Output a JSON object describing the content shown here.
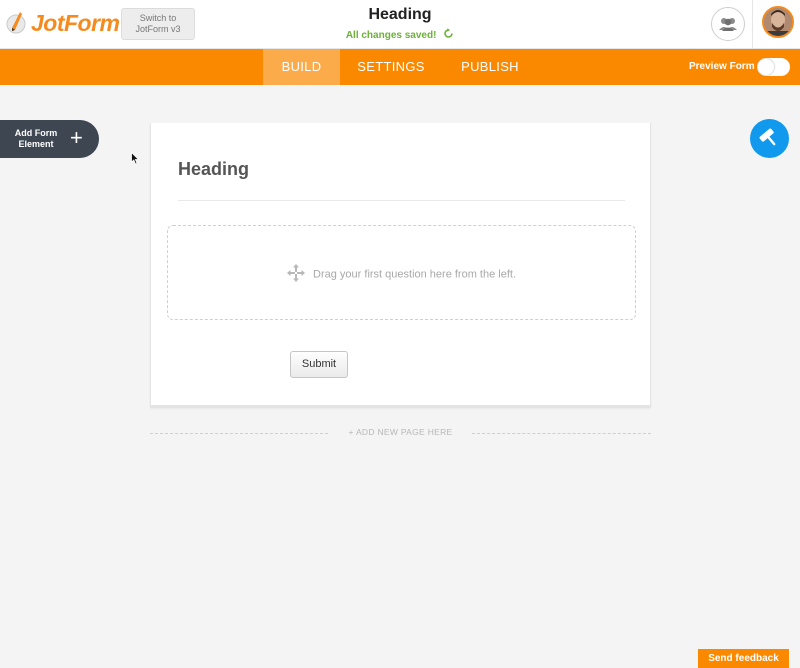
{
  "brand": {
    "name": "JotForm",
    "color": "#f58b1f"
  },
  "header": {
    "switch_line1": "Switch to",
    "switch_line2": "JotForm v3",
    "form_title": "Heading",
    "save_status": "All changes saved!"
  },
  "nav": {
    "tabs": [
      {
        "label": "BUILD",
        "active": true
      },
      {
        "label": "SETTINGS",
        "active": false
      },
      {
        "label": "PUBLISH",
        "active": false
      }
    ],
    "preview_label": "Preview Form",
    "preview_on": false
  },
  "sidebar": {
    "add_element_line1": "Add Form",
    "add_element_line2": "Element",
    "plus_symbol": "+"
  },
  "form": {
    "heading": "Heading",
    "dropzone_text": "Drag your first question here from the left.",
    "submit_label": "Submit",
    "add_page_label": "+ ADD NEW PAGE HERE"
  },
  "footer": {
    "feedback_label": "Send feedback"
  },
  "colors": {
    "orange": "#fa8900",
    "active_tab": "#fbab4a",
    "designer_blue": "#1199ee",
    "dark": "#3d4651",
    "saved_green": "#6bb136"
  },
  "icons": [
    "jotform-logo-icon",
    "refresh-icon",
    "assignees-icon",
    "avatar",
    "plus-icon",
    "move-icon",
    "paint-roller-icon",
    "cursor-icon"
  ]
}
